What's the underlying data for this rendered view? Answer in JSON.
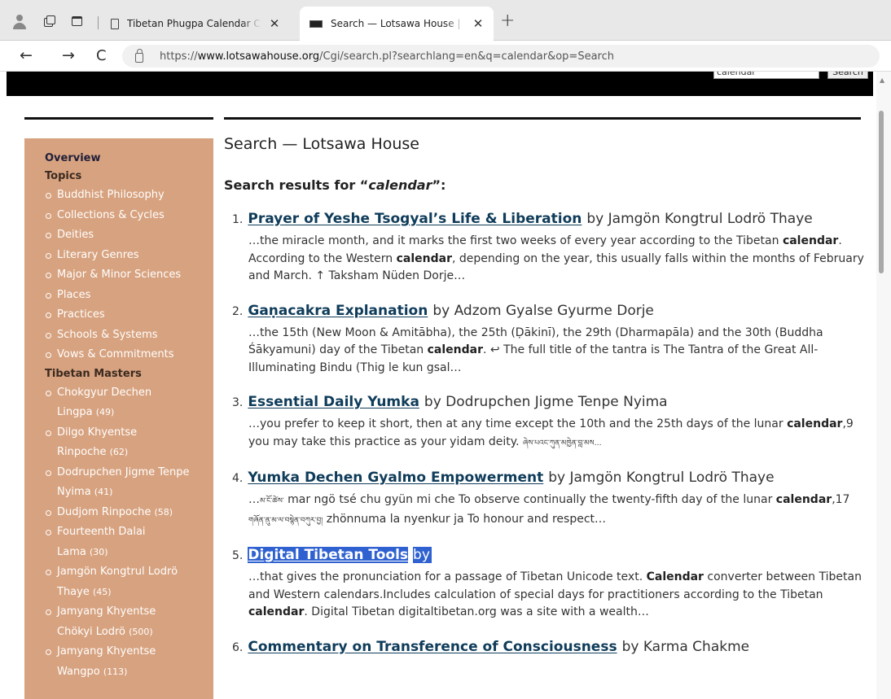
{
  "browser": {
    "tabs": [
      {
        "title": "Tibetan Phugpa Calendar Calcula",
        "active": false
      },
      {
        "title": "Search — Lotsawa House | Lotsaw",
        "active": true
      }
    ],
    "close_glyph": "✕",
    "new_tab_glyph": "+",
    "url_prefix": "https://",
    "url_host": "www.lotsawahouse.org",
    "url_path": "/Cgi/search.pl?searchlang=en&q=calendar&op=Search",
    "back_glyph": "←",
    "forward_glyph": "→",
    "reload_glyph": "C"
  },
  "site_search": {
    "value": "calendar",
    "button_label": "Search"
  },
  "sidebar": {
    "overview": "Overview",
    "topics_heading": "Topics",
    "topics": [
      "Buddhist Philosophy",
      "Collections & Cycles",
      "Deities",
      "Literary Genres",
      "Major & Minor Sciences",
      "Places",
      "Practices",
      "Schools & Systems",
      "Vows & Commitments"
    ],
    "masters_heading": "Tibetan Masters",
    "masters": [
      {
        "line1": "Chokgyur Dechen",
        "line2": "Lingpa",
        "count": "(49)"
      },
      {
        "line1": "Dilgo Khyentse",
        "line2": "Rinpoche",
        "count": "(62)"
      },
      {
        "line1": "Dodrupchen Jigme Tenpe",
        "line2": "Nyima",
        "count": "(41)"
      },
      {
        "line1": "Dudjom Rinpoche",
        "line2": "",
        "count": "(58)"
      },
      {
        "line1": "Fourteenth Dalai",
        "line2": "Lama",
        "count": "(30)"
      },
      {
        "line1": "Jamgön Kongtrul Lodrö",
        "line2": "Thaye",
        "count": "(45)"
      },
      {
        "line1": "Jamyang Khyentse",
        "line2": "Chökyi Lodrö",
        "count": "(500)"
      },
      {
        "line1": "Jamyang Khyentse",
        "line2": "Wangpo",
        "count": "(113)"
      }
    ]
  },
  "main": {
    "page_title": "Search — Lotsawa House",
    "results_prefix": "Search results for “",
    "query": "calendar",
    "results_suffix": "”:",
    "results": [
      {
        "num": "1.",
        "title": "Prayer of Yeshe Tsogyal’s Life & Liberation",
        "by": "by Jamgön Kongtrul Lodrö Thaye",
        "snippet": [
          {
            "t": "…the miracle month, and it marks the first two weeks of every year according to the Tibetan "
          },
          {
            "b": "calendar"
          },
          {
            "t": ". According to the Western "
          },
          {
            "b": "calendar"
          },
          {
            "t": ", depending on the year, this usually falls within the months of February and March. ↑ Taksham Nüden Dorje…"
          }
        ]
      },
      {
        "num": "2.",
        "title": "Gaṇacakra Explanation",
        "by": "by Adzom Gyalse Gyurme Dorje",
        "snippet": [
          {
            "t": "…the 15th (New Moon & Amitābha), the 25th (Ḍākinī), the 29th (Dharmapāla) and the 30th (Buddha Śākyamuni) day of the Tibetan "
          },
          {
            "b": "calendar"
          },
          {
            "t": ".  ↩ The full title of the tantra is The Tantra of the Great All-Illuminating Bindu (Thig le kun gsal…"
          }
        ]
      },
      {
        "num": "3.",
        "title": "Essential Daily Yumka",
        "by": "by Dodrupchen Jigme Tenpe Nyima",
        "snippet": [
          {
            "t": "…you prefer to keep it short, then at any time except the 10th and the 25th days of the lunar "
          },
          {
            "b": "calendar"
          },
          {
            "t": ",9 you may take this practice as your yidam deity.  "
          },
          {
            "tib": "ཞེས་པའང་ཀུན་མཁྱེན་བླ་མས…"
          }
        ]
      },
      {
        "num": "4.",
        "title": "Yumka Dechen Gyalmo Empowerment",
        "by": "by Jamgön Kongtrul Lodrö Thaye",
        "snippet": [
          {
            "t": "…"
          },
          {
            "tib": "མ་ངོ་ཚེས་"
          },
          {
            "t": " mar ngö tsé chu gyün mi che To observe continually the twenty-fifth day of the lunar "
          },
          {
            "b": "calendar"
          },
          {
            "t": ",17 "
          },
          {
            "tib": "གཞོན་ནུ་མ་ལ་བསྙེན་བཀུར་བྱ།"
          },
          {
            "t": " zhönnuma la nyenkur ja To honour and respect…"
          }
        ]
      },
      {
        "num": "5.",
        "title": "Digital Tibetan Tools",
        "by": "by",
        "selected": true,
        "snippet": [
          {
            "t": "…that gives the pronunciation for a passage of Tibetan Unicode text. "
          },
          {
            "b": "Calendar"
          },
          {
            "t": " converter between Tibetan and Western calendars.Includes calculation of special days for practitioners according to the Tibetan "
          },
          {
            "b": "calendar"
          },
          {
            "t": ". Digital Tibetan digitaltibetan.org was a site with a wealth…"
          }
        ]
      },
      {
        "num": "6.",
        "title": "Commentary on Transference of Consciousness",
        "by": "by Karma Chakme",
        "snippet": []
      }
    ]
  },
  "colors": {
    "sidebar_bg": "#d7a27f",
    "link": "#0f3c5a",
    "selection": "#2f62d0"
  },
  "icons": [
    "profile-icon",
    "tab-actions-icon",
    "window-icon",
    "page-icon",
    "lotsawa-favicon",
    "close-icon",
    "plus-icon",
    "back-arrow-icon",
    "forward-arrow-icon",
    "reload-icon",
    "lock-icon"
  ]
}
